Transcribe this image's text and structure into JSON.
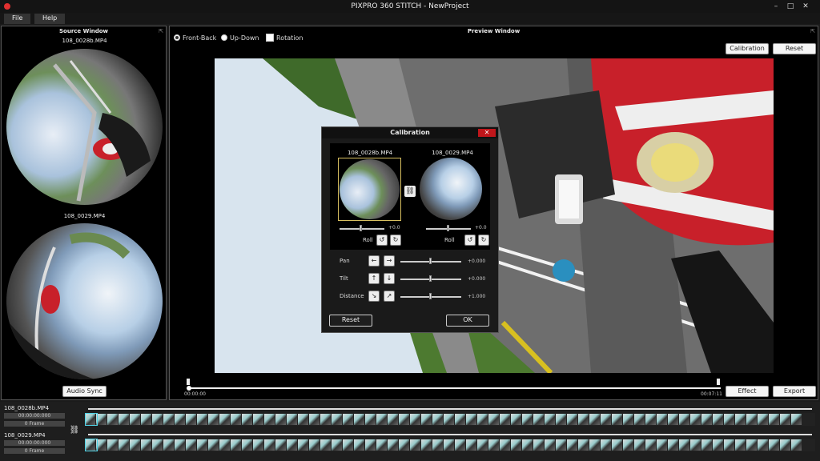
{
  "window": {
    "title": "PIXPRO 360 STITCH - NewProject",
    "controls": [
      "minimize-icon",
      "maximize-icon",
      "close-icon"
    ]
  },
  "menu": {
    "file": "File",
    "help": "Help"
  },
  "source": {
    "title": "Source Window",
    "file1": "108_0028b.MP4",
    "file2": "108_0029.MP4",
    "audio_sync": "Audio Sync"
  },
  "preview": {
    "title": "Preview Window",
    "options": {
      "front_back": "Front-Back",
      "up_down": "Up-Down",
      "rotation": "Rotation",
      "selected": "Front-Back"
    },
    "calibration_btn": "Calibration",
    "reset_btn": "Reset",
    "time_start": "00:00:00",
    "time_end": "00:07:11",
    "effect_btn": "Effect",
    "export_btn": "Export"
  },
  "calibration": {
    "title": "Calibration",
    "close": "✕",
    "file1": "108_0028b.MP4",
    "file2": "108_0029.MP4",
    "roll_value1": "+0.0",
    "roll_value2": "+0.0",
    "roll_label": "Roll",
    "pan_label": "Pan",
    "pan_value": "+0.000",
    "tilt_label": "Tilt",
    "tilt_value": "+0.000",
    "distance_label": "Distance",
    "distance_value": "+1.000",
    "reset_btn": "Reset",
    "ok_btn": "OK"
  },
  "timeline": {
    "track1": {
      "name": "108_0028b.MP4",
      "time": "00:00:00:000",
      "frame": "0 Frame"
    },
    "track2": {
      "name": "108_0029.MP4",
      "time": "00:00:00:000",
      "frame": "0 Frame"
    }
  }
}
